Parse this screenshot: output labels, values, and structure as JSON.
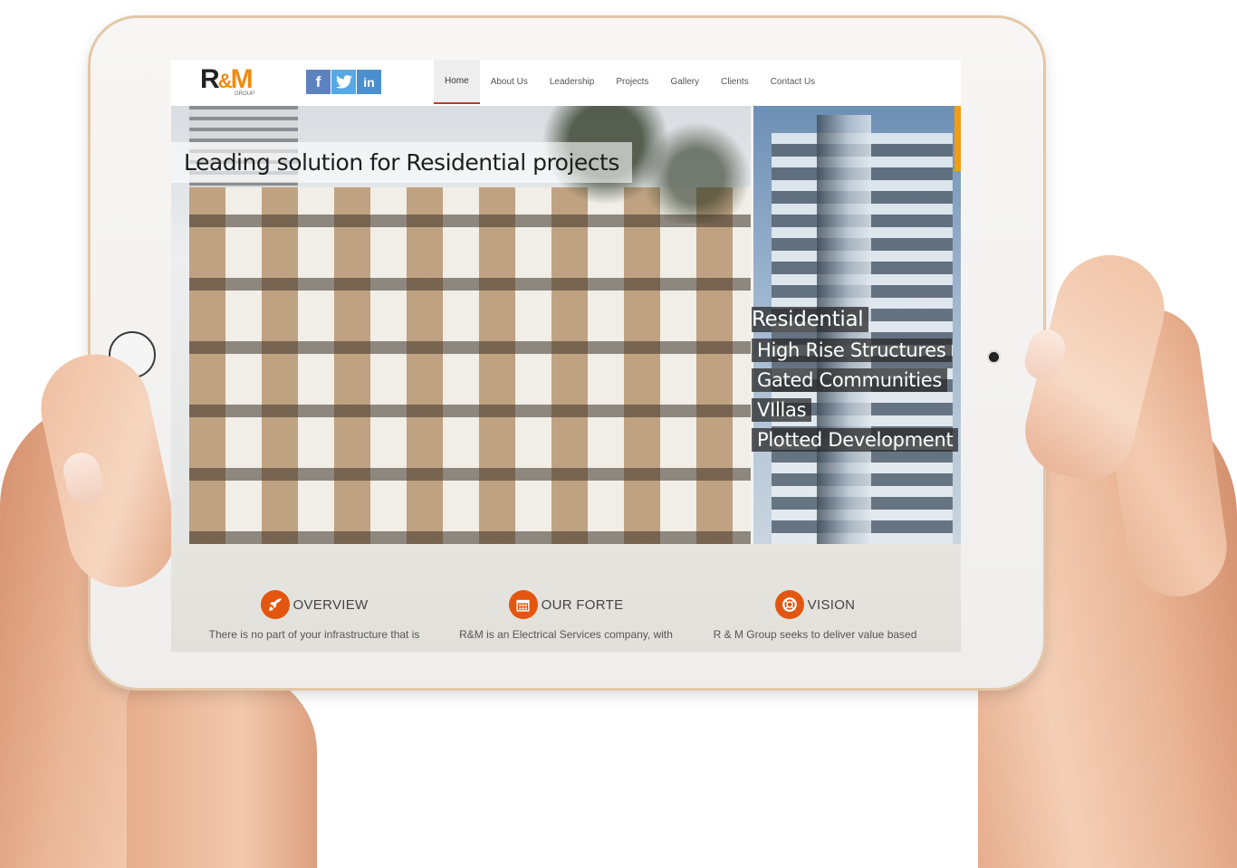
{
  "brand": {
    "logo_main": "R&M",
    "logo_sub": "GROUP"
  },
  "social": [
    {
      "name": "facebook",
      "glyph": "f"
    },
    {
      "name": "twitter",
      "glyph": "t"
    },
    {
      "name": "linkedin",
      "glyph": "in"
    }
  ],
  "nav": {
    "items": [
      {
        "label": "Home",
        "active": true
      },
      {
        "label": "About Us"
      },
      {
        "label": "Leadership"
      },
      {
        "label": "Projects"
      },
      {
        "label": "Gallery"
      },
      {
        "label": "Clients"
      },
      {
        "label": "Contact Us"
      }
    ]
  },
  "hero": {
    "title": "Leading solution for Residential projects",
    "category": "Residential",
    "features": [
      "High Rise Structures",
      "Gated Communities",
      "VIllas",
      "Plotted Development"
    ]
  },
  "services": [
    {
      "title": "OVERVIEW",
      "icon": "rocket-icon",
      "text": "There is no part of your infrastructure that is"
    },
    {
      "title": "OUR FORTE",
      "icon": "calendar-icon",
      "text": "R&M is an Electrical Services company, with"
    },
    {
      "title": "VISION",
      "icon": "lifebuoy-icon",
      "text": "R & M Group seeks to deliver value based"
    }
  ],
  "colors": {
    "accent": "#e3560f",
    "nav_active_underline": "#c0392b",
    "brand_orange": "#f18a10"
  }
}
